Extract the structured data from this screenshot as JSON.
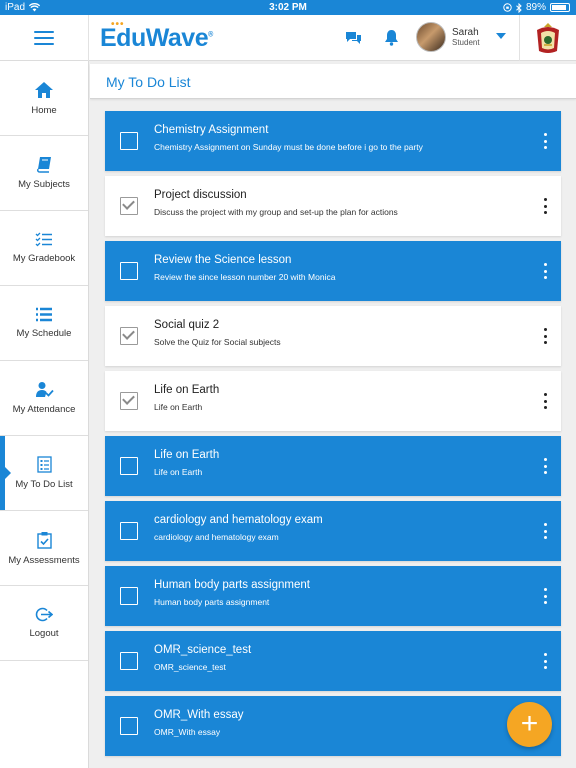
{
  "status_bar": {
    "device": "iPad",
    "time": "3:02 PM",
    "battery_text": "89%",
    "battery_level": 0.89
  },
  "header": {
    "logo_text": "EduWave",
    "logo_mark": "®",
    "user": {
      "name": "Sarah",
      "role": "Student"
    }
  },
  "sidebar": {
    "items": [
      {
        "label": "Home",
        "icon": "home-icon",
        "active": false
      },
      {
        "label": "My Subjects",
        "icon": "book-icon",
        "active": false
      },
      {
        "label": "My Gradebook",
        "icon": "checklist-icon",
        "active": false
      },
      {
        "label": "My Schedule",
        "icon": "list-icon",
        "active": false
      },
      {
        "label": "My Attendance",
        "icon": "user-check-icon",
        "active": false
      },
      {
        "label": "My To Do List",
        "icon": "todo-list-icon",
        "active": true
      },
      {
        "label": "My Assessments",
        "icon": "clipboard-check-icon",
        "active": false
      },
      {
        "label": "Logout",
        "icon": "logout-icon",
        "active": false
      }
    ]
  },
  "page": {
    "title": "My To Do List"
  },
  "todos": [
    {
      "title": "Chemistry Assignment",
      "description": "Chemistry Assignment on Sunday must be done before i go to the party",
      "done": false
    },
    {
      "title": "Project discussion",
      "description": "Discuss the project with my group and set-up the plan for actions",
      "done": true
    },
    {
      "title": "Review the Science lesson",
      "description": "Review the since lesson number 20 with Monica",
      "done": false
    },
    {
      "title": "Social quiz 2",
      "description": "Solve the Quiz for Social subjects",
      "done": true
    },
    {
      "title": "Life on Earth",
      "description": "Life on Earth",
      "done": true
    },
    {
      "title": "Life on Earth",
      "description": "Life on Earth",
      "done": false
    },
    {
      "title": "cardiology and hematology exam",
      "description": "cardiology and hematology exam",
      "done": false
    },
    {
      "title": "Human body parts assignment",
      "description": "Human body parts assignment",
      "done": false
    },
    {
      "title": "OMR_science_test",
      "description": "OMR_science_test",
      "done": false
    },
    {
      "title": "OMR_With essay",
      "description": "OMR_With essay",
      "done": false
    }
  ],
  "fab": {
    "label": "+"
  },
  "colors": {
    "primary": "#1a86d6",
    "accent": "#f5a623",
    "background": "#efefef"
  }
}
